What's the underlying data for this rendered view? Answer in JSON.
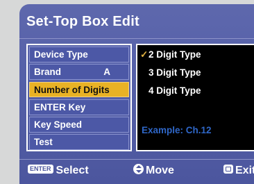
{
  "screen": {
    "title": "Set-Top Box Edit"
  },
  "menu": {
    "items": [
      {
        "label": "Device Type",
        "value": ""
      },
      {
        "label": "Brand",
        "value": "A"
      },
      {
        "label": "Number of Digits",
        "value": "",
        "selected": true
      },
      {
        "label": "ENTER Key",
        "value": ""
      },
      {
        "label": "Key Speed",
        "value": ""
      },
      {
        "label": "Test",
        "value": ""
      }
    ]
  },
  "options": {
    "items": [
      {
        "label": "2 Digit Type",
        "checked": true,
        "check_mark": "✓"
      },
      {
        "label": "3 Digit Type",
        "checked": false
      },
      {
        "label": "4 Digit Type",
        "checked": false
      }
    ],
    "example": "Example: Ch.12"
  },
  "footer": {
    "select": {
      "badge": "ENTER",
      "label": "Select"
    },
    "move": {
      "label": "Move"
    },
    "exit": {
      "label": "Exit"
    }
  },
  "colors": {
    "panel_bg": "#5560a8",
    "menu_selected": "#e8b225",
    "example_text": "#2f67c8",
    "check_mark": "#e0b040"
  }
}
